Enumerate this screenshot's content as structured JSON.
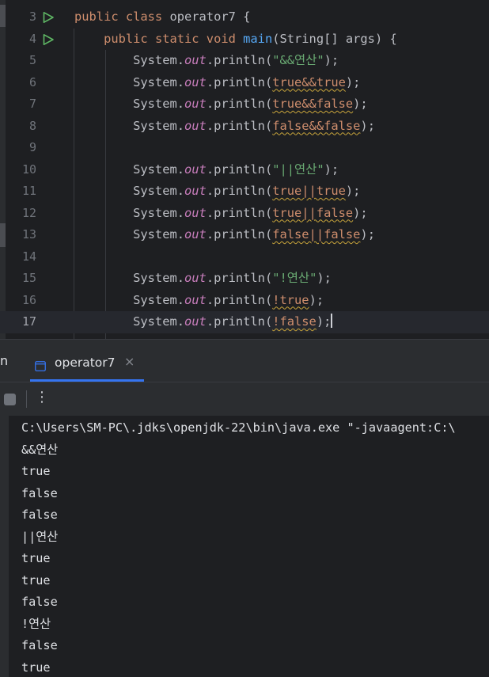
{
  "editor": {
    "lines": [
      {
        "num": "3",
        "run": true,
        "segments": [
          [
            "kw",
            "public class "
          ],
          [
            "plain",
            "operator7 {"
          ]
        ]
      },
      {
        "num": "4",
        "run": true,
        "segments": [
          [
            "plain",
            "    "
          ],
          [
            "kw",
            "public static void "
          ],
          [
            "fn",
            "main"
          ],
          [
            "plain",
            "(String[] args) {"
          ]
        ]
      },
      {
        "num": "5",
        "segments": [
          [
            "plain",
            "        System."
          ],
          [
            "fld",
            "out"
          ],
          [
            "plain",
            ".println("
          ],
          [
            "str",
            "\"&&연산\""
          ],
          [
            "plain",
            ");"
          ]
        ]
      },
      {
        "num": "6",
        "segments": [
          [
            "plain",
            "        System."
          ],
          [
            "fld",
            "out"
          ],
          [
            "plain",
            ".println("
          ],
          [
            "kwwarn",
            "true&&true"
          ],
          [
            "plain",
            ");"
          ]
        ]
      },
      {
        "num": "7",
        "segments": [
          [
            "plain",
            "        System."
          ],
          [
            "fld",
            "out"
          ],
          [
            "plain",
            ".println("
          ],
          [
            "kwwarn",
            "true&&false"
          ],
          [
            "plain",
            ");"
          ]
        ]
      },
      {
        "num": "8",
        "segments": [
          [
            "plain",
            "        System."
          ],
          [
            "fld",
            "out"
          ],
          [
            "plain",
            ".println("
          ],
          [
            "kwwarn",
            "false&&false"
          ],
          [
            "plain",
            ");"
          ]
        ]
      },
      {
        "num": "9",
        "segments": []
      },
      {
        "num": "10",
        "segments": [
          [
            "plain",
            "        System."
          ],
          [
            "fld",
            "out"
          ],
          [
            "plain",
            ".println("
          ],
          [
            "str",
            "\"||연산\""
          ],
          [
            "plain",
            ");"
          ]
        ]
      },
      {
        "num": "11",
        "segments": [
          [
            "plain",
            "        System."
          ],
          [
            "fld",
            "out"
          ],
          [
            "plain",
            ".println("
          ],
          [
            "kwwarn",
            "true||true"
          ],
          [
            "plain",
            ");"
          ]
        ]
      },
      {
        "num": "12",
        "segments": [
          [
            "plain",
            "        System."
          ],
          [
            "fld",
            "out"
          ],
          [
            "plain",
            ".println("
          ],
          [
            "kwwarn",
            "true||false"
          ],
          [
            "plain",
            ");"
          ]
        ]
      },
      {
        "num": "13",
        "segments": [
          [
            "plain",
            "        System."
          ],
          [
            "fld",
            "out"
          ],
          [
            "plain",
            ".println("
          ],
          [
            "kwwarn",
            "false||false"
          ],
          [
            "plain",
            ");"
          ]
        ]
      },
      {
        "num": "14",
        "segments": []
      },
      {
        "num": "15",
        "segments": [
          [
            "plain",
            "        System."
          ],
          [
            "fld",
            "out"
          ],
          [
            "plain",
            ".println("
          ],
          [
            "str",
            "\"!연산\""
          ],
          [
            "plain",
            ");"
          ]
        ]
      },
      {
        "num": "16",
        "segments": [
          [
            "plain",
            "        System."
          ],
          [
            "fld",
            "out"
          ],
          [
            "plain",
            ".println("
          ],
          [
            "kwwarn",
            "!true"
          ],
          [
            "plain",
            ");"
          ]
        ]
      },
      {
        "num": "17",
        "current": true,
        "caret": true,
        "segments": [
          [
            "plain",
            "        System."
          ],
          [
            "fld",
            "out"
          ],
          [
            "plain",
            ".println("
          ],
          [
            "kwwarn",
            "!false"
          ],
          [
            "plain",
            ");"
          ]
        ]
      }
    ]
  },
  "toolwindow": {
    "run_tab_cut_label": "n",
    "tab_label": "operator7",
    "close_glyph": "×",
    "more_glyph": "⋮"
  },
  "console": {
    "lines": [
      "C:\\Users\\SM-PC\\.jdks\\openjdk-22\\bin\\java.exe \"-javaagent:C:\\",
      "&&연산",
      "true",
      "false",
      "false",
      "||연산",
      "true",
      "true",
      "false",
      "!연산",
      "false",
      "true"
    ]
  },
  "colors": {
    "keyword": "#cf8e6d",
    "method": "#56a8f5",
    "field": "#c77dbb",
    "string": "#6aab73",
    "text": "#bcbec4",
    "run_gutter": "#5fb865",
    "accent": "#3574f0"
  }
}
